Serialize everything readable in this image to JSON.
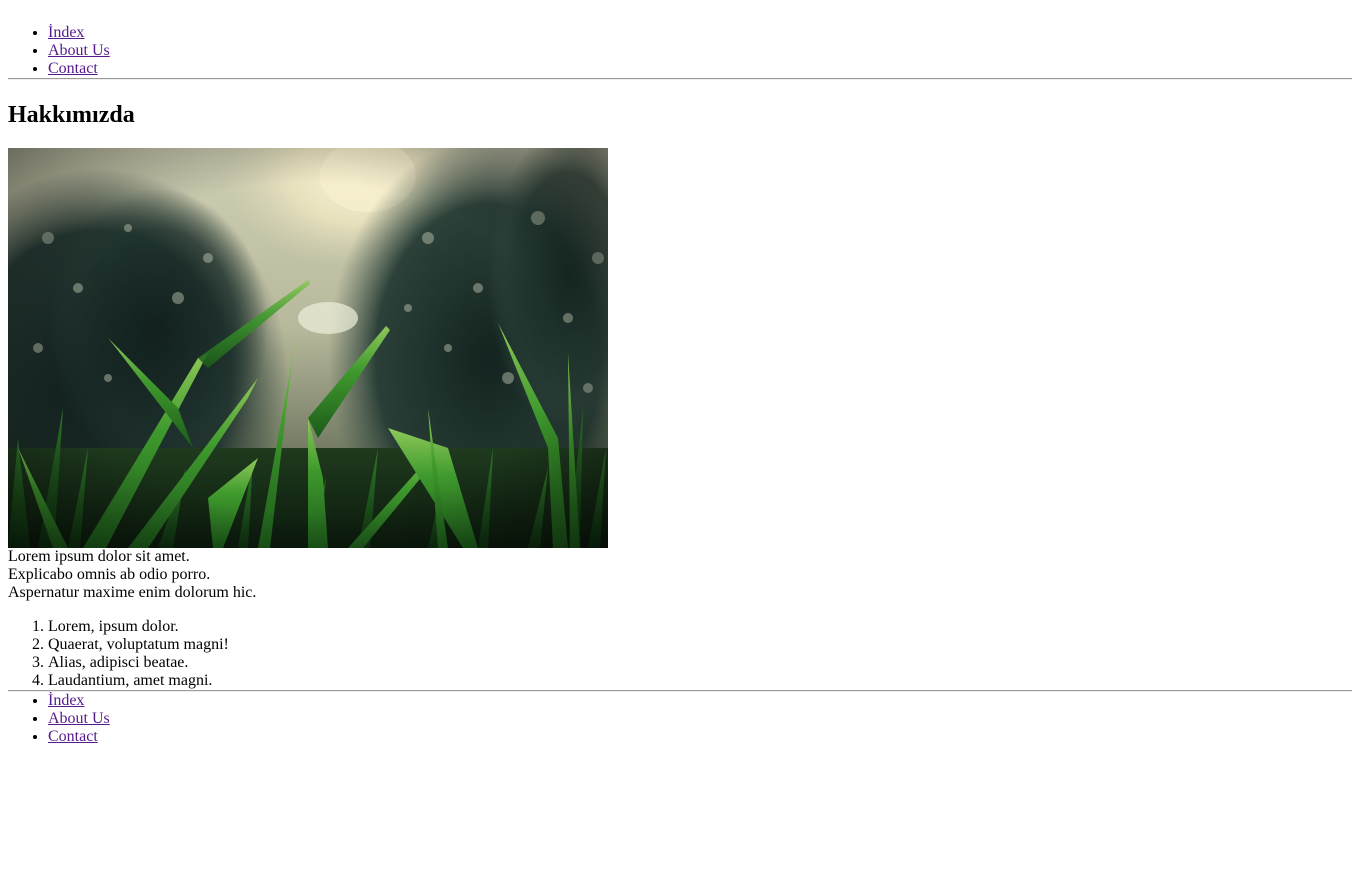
{
  "header_nav": {
    "items": [
      {
        "label": "İndex"
      },
      {
        "label": "About Us"
      },
      {
        "label": "Contact"
      }
    ]
  },
  "main": {
    "heading": "Hakkımızda",
    "image": {
      "subject": "grass blades in sunlight with blurred trees"
    },
    "paragraphs": [
      "Lorem ipsum dolor sit amet.",
      "Explicabo omnis ab odio porro.",
      "Aspernatur maxime enim dolorum hic."
    ],
    "list": [
      "Lorem, ipsum dolor.",
      "Quaerat, voluptatum magni!",
      "Alias, adipisci beatae.",
      "Laudantium, amet magni."
    ]
  },
  "footer_nav": {
    "items": [
      {
        "label": "İndex"
      },
      {
        "label": "About Us"
      },
      {
        "label": "Contact"
      }
    ]
  },
  "colors": {
    "link_visited": "#551a8b",
    "text": "#000000",
    "rule": "#9a9a9a"
  }
}
